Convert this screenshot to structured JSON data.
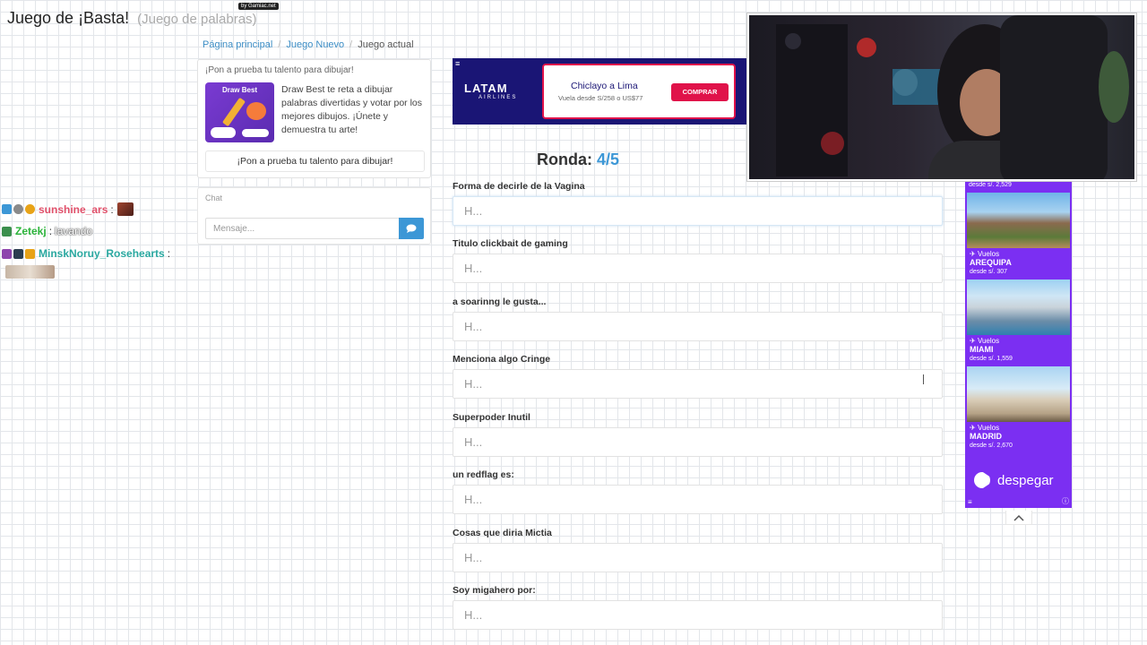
{
  "header": {
    "title": "Juego de ¡Basta!",
    "subtitle": "(Juego de palabras)",
    "by_badge": "by Gamiac.net"
  },
  "breadcrumb": {
    "home": "Página principal",
    "new_game": "Juego Nuevo",
    "current": "Juego actual"
  },
  "promo": {
    "title": "¡Pon a prueba tu talento para dibujar!",
    "thumb_label": "Draw Best",
    "description": "Draw Best te reta a dibujar palabras divertidas y votar por los mejores dibujos. ¡Únete y demuestra tu arte!",
    "button": "¡Pon a prueba tu talento para dibujar!"
  },
  "chat": {
    "title": "Chat",
    "placeholder": "Mensaje...",
    "send_icon": "comment-icon"
  },
  "stream_chat": [
    {
      "user": "sunshine_ars",
      "separator": ":",
      "message": "",
      "color": "#e0506a"
    },
    {
      "user": "Zetekj",
      "separator": ":",
      "message": "lavando",
      "color": "#2bb33a"
    },
    {
      "user": "MinskNoruy_Rosehearts",
      "separator": ":",
      "message": "",
      "color": "#2aa8a0"
    }
  ],
  "ad_latam": {
    "logo": "LATAM",
    "logo_sub": "AIRLINES",
    "route": "Chiclayo a Lima",
    "price": "Vuela desde S/258 o US$77",
    "button": "COMPRAR"
  },
  "round": {
    "label": "Ronda:",
    "value": "4/5"
  },
  "categories": [
    {
      "label": "Forma de decirle de la Vagina",
      "placeholder": "H..."
    },
    {
      "label": "Titulo clickbait de gaming",
      "placeholder": "H..."
    },
    {
      "label": "a soarinng le gusta...",
      "placeholder": "H..."
    },
    {
      "label": "Menciona algo Cringe",
      "placeholder": "H..."
    },
    {
      "label": "Superpoder Inutil",
      "placeholder": "H..."
    },
    {
      "label": "un redflag es:",
      "placeholder": "H..."
    },
    {
      "label": "Cosas que diria Mictia",
      "placeholder": "H..."
    },
    {
      "label": "Soy migahero por:",
      "placeholder": "H..."
    }
  ],
  "ad_despegar": {
    "top_price": "desde s/. 2,529",
    "deals": [
      {
        "tag": "Vuelos",
        "city": "AREQUIPA",
        "price": "desde s/. 307"
      },
      {
        "tag": "Vuelos",
        "city": "MIAMI",
        "price": "desde s/. 1,559"
      },
      {
        "tag": "Vuelos",
        "city": "MADRID",
        "price": "desde s/. 2,670"
      }
    ],
    "logo": "despegar"
  },
  "colors": {
    "link": "#3c8dc5",
    "accent": "#3c97d6",
    "latam_bg": "#1a1575",
    "latam_accent": "#e0124a",
    "despegar_bg": "#7b2ff2"
  }
}
